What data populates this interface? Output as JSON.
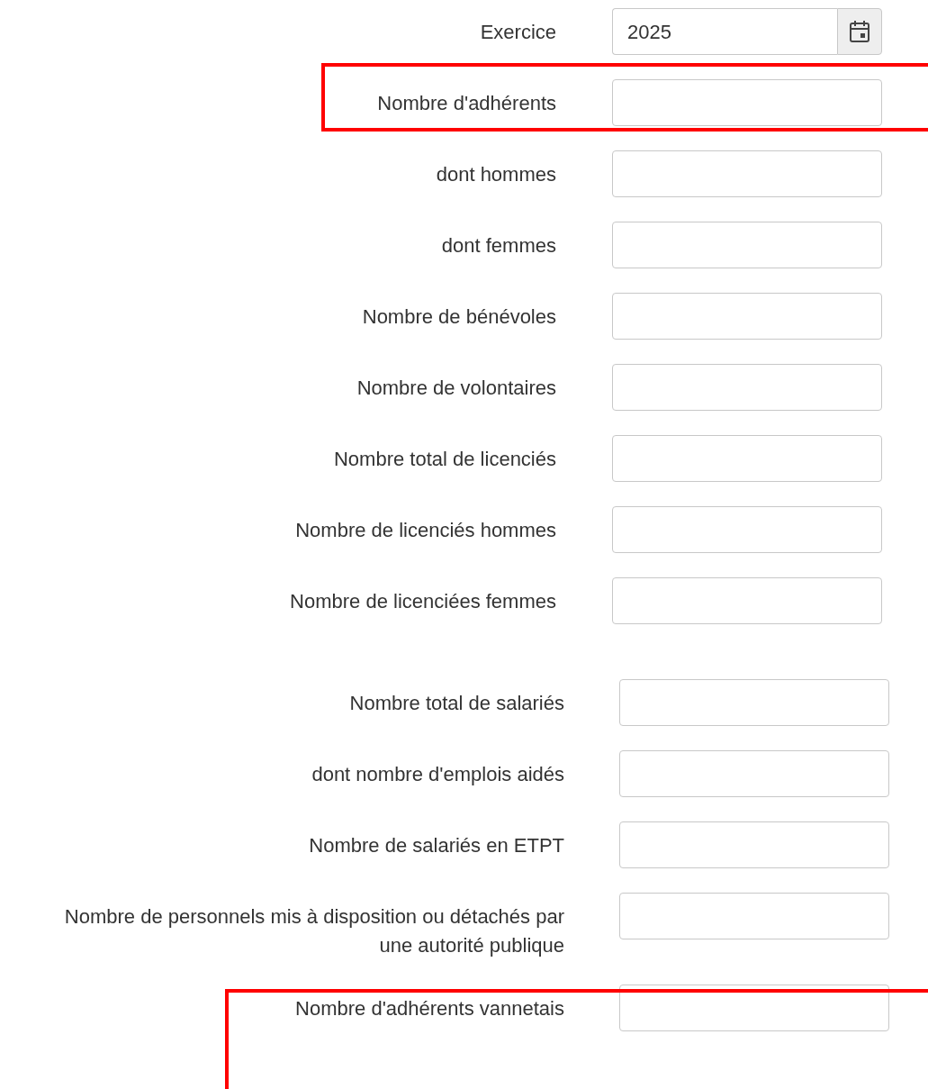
{
  "groups": [
    {
      "fields": [
        {
          "label": "Exercice",
          "kind": "date",
          "value": "2025",
          "highlighted": false
        },
        {
          "label": "Nombre d'adhérents",
          "kind": "number",
          "highlighted": true
        },
        {
          "label": "dont hommes",
          "kind": "number",
          "highlighted": false
        },
        {
          "label": "dont femmes",
          "kind": "number",
          "highlighted": false
        },
        {
          "label": "Nombre de bénévoles",
          "kind": "number",
          "highlighted": false
        },
        {
          "label": "Nombre de volontaires",
          "kind": "number",
          "highlighted": false
        },
        {
          "label": "Nombre total de licenciés",
          "kind": "number",
          "highlighted": false
        },
        {
          "label": "Nombre de licenciés hommes",
          "kind": "number",
          "highlighted": false
        },
        {
          "label": "Nombre de licenciées femmes",
          "kind": "number",
          "highlighted": false
        }
      ]
    },
    {
      "fields": [
        {
          "label": "Nombre total de salariés",
          "kind": "number",
          "highlighted": false
        },
        {
          "label": "dont nombre d'emplois aidés",
          "kind": "number",
          "highlighted": false
        },
        {
          "label": "Nombre de salariés en ETPT",
          "kind": "number",
          "highlighted": false
        },
        {
          "label": "Nombre de personnels mis à disposition ou détachés par une autorité publique",
          "kind": "number",
          "highlighted": false
        },
        {
          "label": "Nombre d'adhérents vannetais",
          "kind": "number",
          "highlighted": true
        }
      ]
    }
  ]
}
